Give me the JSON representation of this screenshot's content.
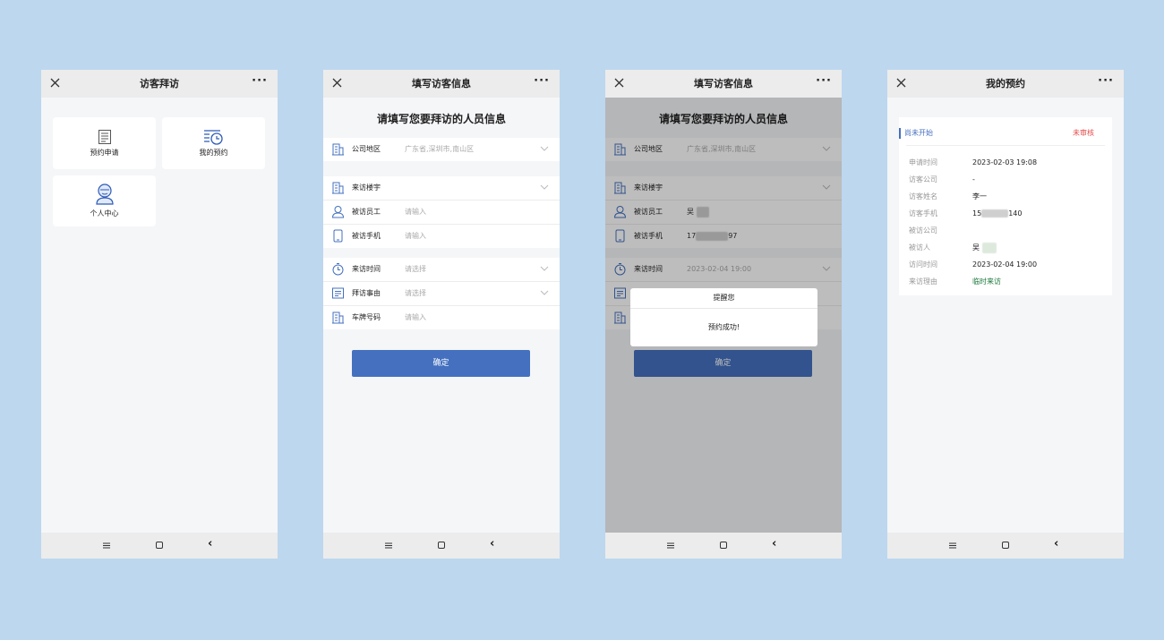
{
  "common": {
    "close_icon": "close-icon",
    "more_icon": "more-icon",
    "more_label": "···",
    "nav_back_label": "‹"
  },
  "screen1": {
    "title": "访客拜访",
    "tiles": [
      {
        "label": "预约申请",
        "icon": "form-document-icon"
      },
      {
        "label": "我的预约",
        "icon": "list-clock-icon"
      },
      {
        "label": "个人中心",
        "icon": "user-icon"
      }
    ]
  },
  "screen2": {
    "title": "填写访客信息",
    "page_title": "请填写您要拜访的人员信息",
    "rows": [
      {
        "label": "公司地区",
        "value": "广东省,深圳市,南山区"
      },
      {
        "label": "来访楼宇",
        "value": ""
      },
      {
        "label": "被访员工",
        "placeholder": "请输入"
      },
      {
        "label": "被访手机",
        "placeholder": "请输入"
      },
      {
        "label": "来访时间",
        "value": "请选择"
      },
      {
        "label": "拜访事由",
        "value": "请选择"
      },
      {
        "label": "车牌号码",
        "placeholder": "请输入"
      }
    ],
    "confirm_label": "确定"
  },
  "screen3": {
    "title": "填写访客信息",
    "page_title": "请填写您要拜访的人员信息",
    "rows": [
      {
        "label": "公司地区",
        "value": "广东省,深圳市,南山区"
      },
      {
        "label": "来访楼宇",
        "value": ""
      },
      {
        "label": "被访员工",
        "value": "吴"
      },
      {
        "label": "被访手机",
        "value_prefix": "17",
        "value_suffix": "97"
      },
      {
        "label": "来访时间",
        "value": "2023-02-04 19:00"
      }
    ],
    "confirm_label": "确定",
    "dialog": {
      "title": "提醒您",
      "message": "预约成功!"
    }
  },
  "screen4": {
    "title": "我的预约",
    "status": "尚未开始",
    "audit": "未审核",
    "fields": [
      {
        "key": "申请时间",
        "value": "2023-02-03 19:08"
      },
      {
        "key": "访客公司",
        "value": "-"
      },
      {
        "key": "访客姓名",
        "value": "李一"
      },
      {
        "key": "访客手机",
        "value_prefix": "15",
        "value_suffix": "140"
      },
      {
        "key": "被访公司",
        "value": ""
      },
      {
        "key": "被访人",
        "value": "吴"
      },
      {
        "key": "访问时间",
        "value": "2023-02-04 19:00"
      },
      {
        "key": "来访理由",
        "value": "临时来访"
      }
    ]
  },
  "colors": {
    "accent": "#4470bf",
    "alert": "#e34b4b",
    "reason": "#1f7a3d",
    "background": "#bdd7ee"
  }
}
